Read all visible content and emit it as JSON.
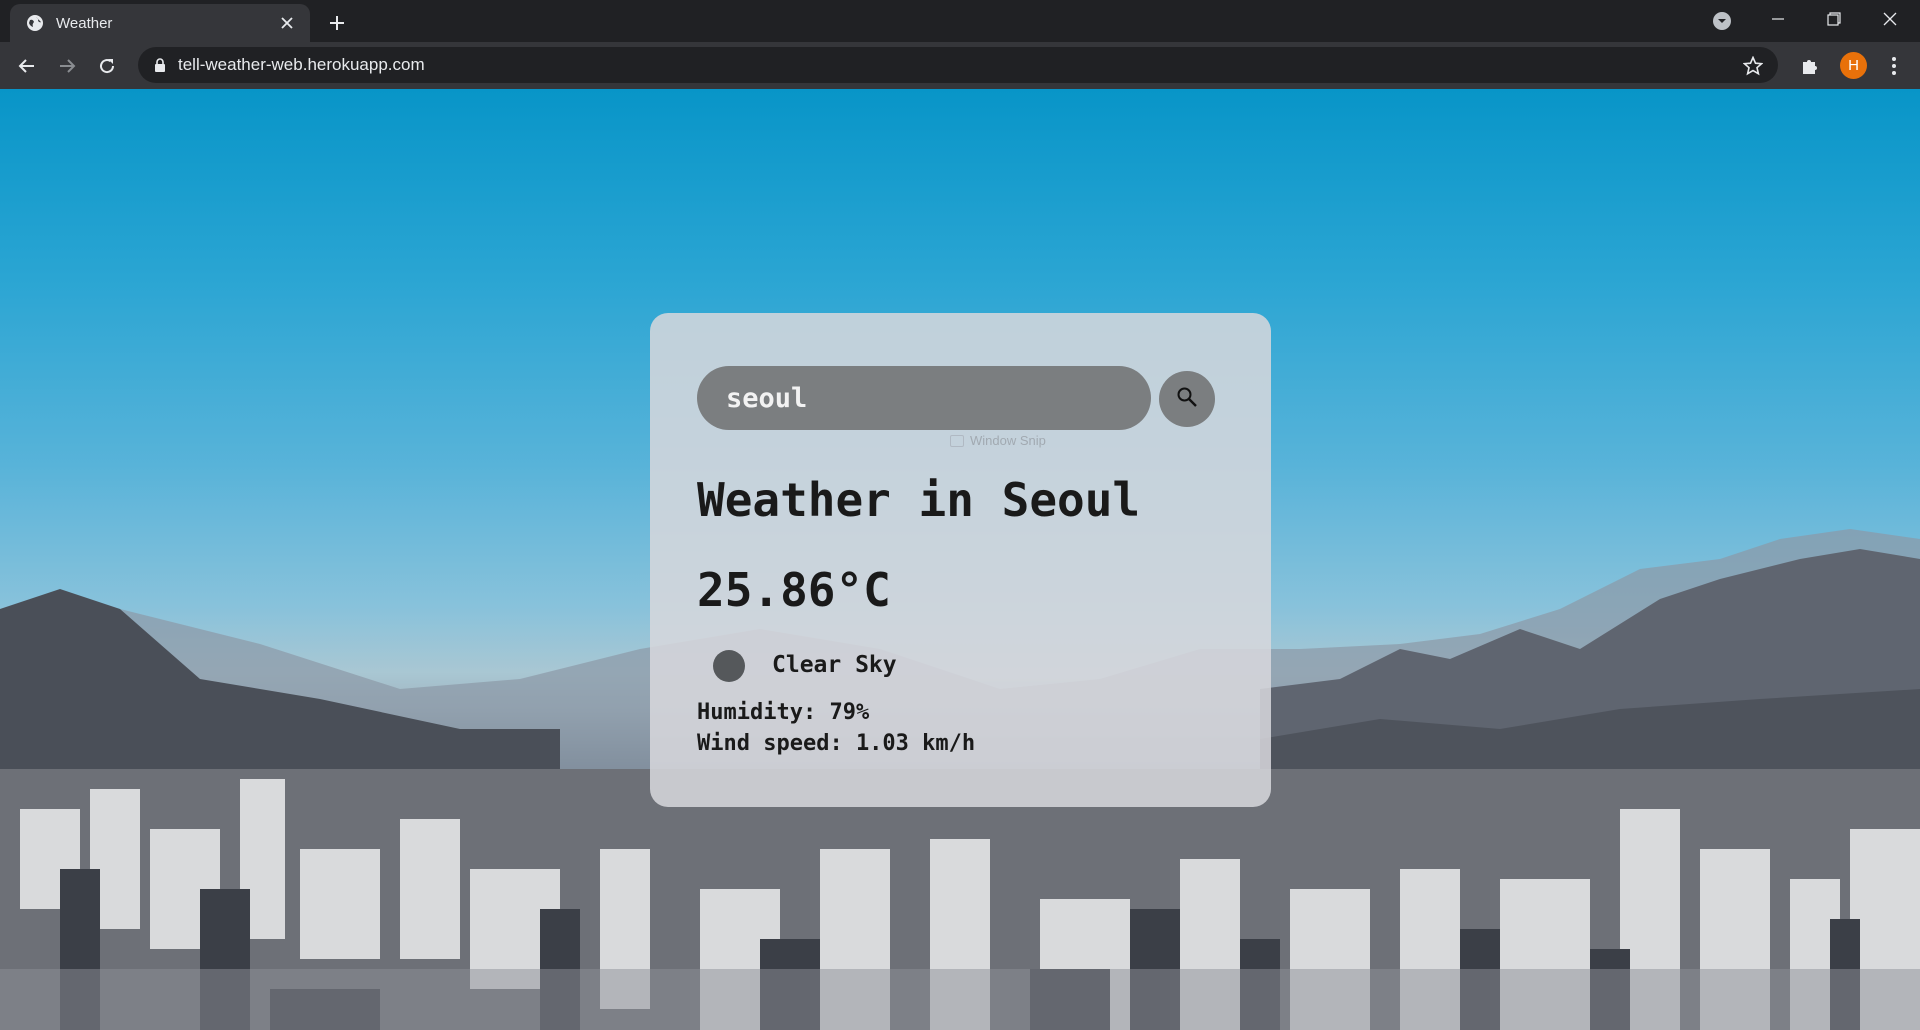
{
  "browser": {
    "tab_title": "Weather",
    "url": "tell-weather-web.herokuapp.com",
    "profile_initial": "H",
    "profile_color": "#e8710a"
  },
  "weather_card": {
    "search_value": "seoul",
    "title": "Weather in Seoul",
    "temperature": "25.86°C",
    "description": "Clear Sky",
    "humidity": "Humidity: 79%",
    "wind_speed": "Wind speed: 1.03 km/h",
    "overlay_hint": "Window Snip"
  },
  "icons": {
    "tab_favicon": "globe-icon",
    "tab_close": "close-icon",
    "new_tab": "plus-icon",
    "tab_search": "chevron-down-circle-icon",
    "back": "arrow-left-icon",
    "forward": "arrow-right-icon",
    "reload": "reload-icon",
    "lock": "lock-icon",
    "bookmark": "star-icon",
    "extensions": "puzzle-icon",
    "menu": "kebab-menu-icon",
    "search": "search-icon",
    "weather": "weather-icon"
  },
  "colors": {
    "sky_top": "#0895c8",
    "card_bg": "#d7d7dc",
    "search_bar_bg": "#7b7e80",
    "text": "#1a1a1a"
  }
}
